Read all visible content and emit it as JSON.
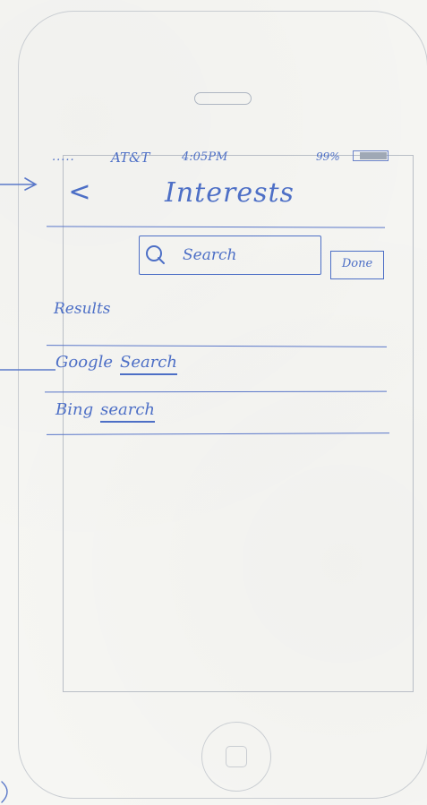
{
  "status_bar": {
    "signal": ".....",
    "carrier": "AT&T",
    "time": "4:05PM",
    "battery": "99%"
  },
  "nav": {
    "back_label": "<",
    "title": "Interests"
  },
  "search": {
    "placeholder": "Search",
    "done_label": "Done"
  },
  "results": {
    "heading": "Results",
    "items": [
      {
        "prefix": "Google",
        "link": "Search"
      },
      {
        "prefix": "Bing",
        "link": "search"
      }
    ]
  },
  "colors": {
    "ink": "#4d6fc6",
    "device_outline": "#c9cdd2",
    "paper": "#f6f6f3"
  },
  "icons": [
    "search-icon",
    "battery-icon",
    "chevron-left-icon",
    "home-button-icon",
    "annotation-arrow-icon"
  ]
}
